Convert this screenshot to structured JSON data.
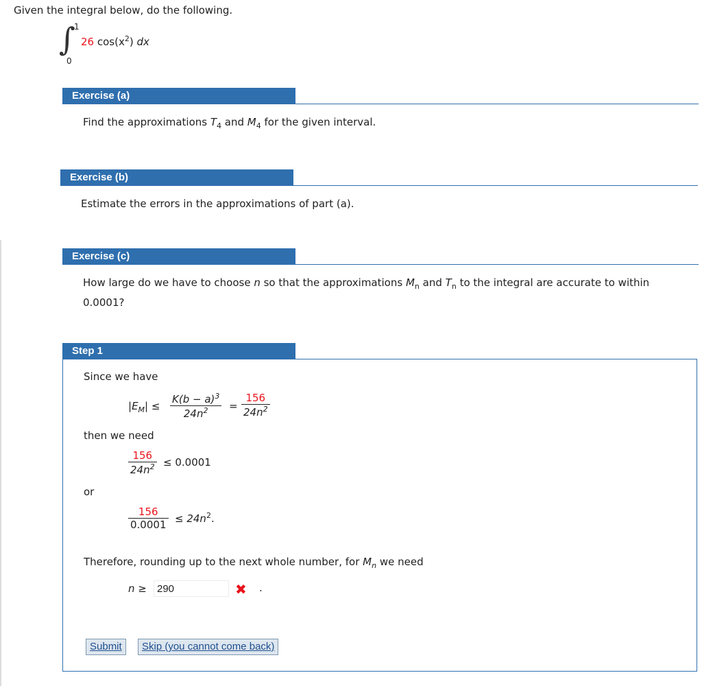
{
  "intro": {
    "text": "Given the integral below, do the following.",
    "integral": {
      "upper": "1",
      "lower": "0",
      "coef": "26",
      "func": "cos(x",
      "func_sup": "2",
      "func_close": ")",
      "dx": "dx"
    }
  },
  "exercise_a": {
    "header": "Exercise (a)",
    "text_pre": "Find the approximations ",
    "t": "T",
    "t_sub": "4",
    "mid": " and ",
    "m": "M",
    "m_sub": "4",
    "text_post": " for the given interval."
  },
  "exercise_b": {
    "header": "Exercise (b)",
    "text": "Estimate the errors in the approximations of part (a)."
  },
  "exercise_c": {
    "header": "Exercise (c)",
    "line1_pre": "How large do we have to choose ",
    "n": "n",
    "line1_mid": " so that the approximations ",
    "m": "M",
    "m_sub": "n",
    "and": " and ",
    "t": "T",
    "t_sub": "n",
    "line1_post": " to the integral are accurate to within",
    "line2": "0.0001?"
  },
  "step1": {
    "header": "Step 1",
    "since": "Since we have",
    "em_bar_left": "|",
    "em": "E",
    "em_sub": "M",
    "em_bar_right": "|",
    "leq": "≤",
    "f1_num": "K(b − a)",
    "f1_num_sup": "3",
    "f1_den": "24n",
    "f1_den_sup": "2",
    "eq": "=",
    "f2_num": "156",
    "f2_den": "24n",
    "f2_den_sup": "2",
    "then": "then we need",
    "f3_num": "156",
    "f3_den": "24n",
    "f3_den_sup": "2",
    "f3_rhs": "≤ 0.0001",
    "or": "or",
    "f4_num": "156",
    "f4_den": "0.0001",
    "f4_rhs": "≤ 24n",
    "f4_rhs_sup": "2",
    "f4_rhs_end": ".",
    "therefore_pre": "Therefore, rounding up to the next whole number, for ",
    "therefore_m": "M",
    "therefore_m_sub": "n",
    "therefore_post": " we need",
    "n_label": "n ≥",
    "answer_value": "290",
    "wrong_mark": "✖",
    "period": ".",
    "submit_label": "Submit",
    "skip_label": "Skip (you cannot come back)"
  },
  "colors": {
    "accent": "#2f6fae",
    "red": "#e8141c",
    "button_bg": "#dde6ee"
  }
}
